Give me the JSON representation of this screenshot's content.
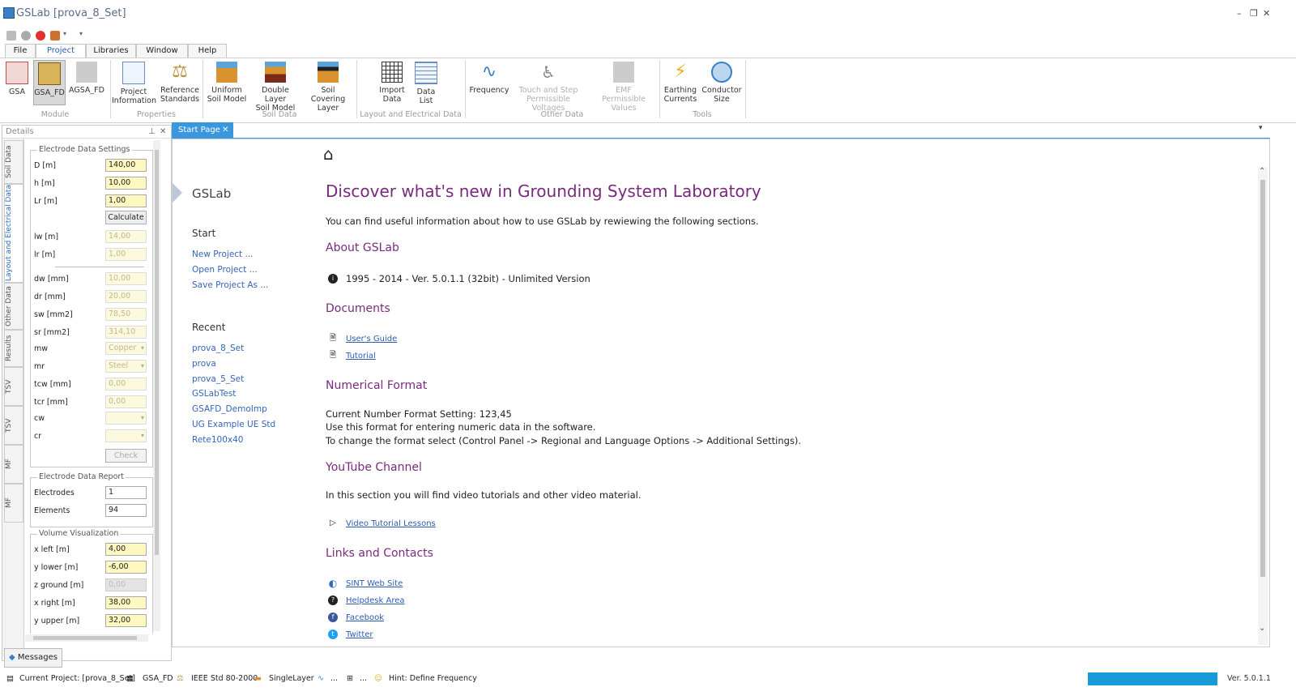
{
  "window": {
    "title": "GSLab [prova_8_Set]"
  },
  "menu_tabs": [
    "File",
    "Project",
    "Libraries",
    "Window",
    "Help"
  ],
  "ribbon": {
    "module": {
      "label": "Module",
      "buttons": [
        "GSA",
        "GSA_FD",
        "AGSA_FD"
      ]
    },
    "properties": {
      "label": "Properties",
      "buttons": [
        [
          "Project",
          "Information"
        ],
        [
          "Reference",
          "Standards"
        ]
      ]
    },
    "soil": {
      "label": "Soil Data",
      "buttons": [
        [
          "Uniform",
          "Soil Model"
        ],
        [
          "Double Layer",
          "Soil Model"
        ],
        [
          "Soil Covering",
          "Layer"
        ]
      ]
    },
    "layout": {
      "label": "Layout and Electrical Data",
      "buttons": [
        [
          "Import",
          "Data"
        ],
        [
          "Data List",
          ""
        ]
      ]
    },
    "other": {
      "label": "Other Data",
      "buttons": [
        [
          "Frequency",
          ""
        ],
        [
          "Touch and Step",
          "Permissible Voltages"
        ],
        [
          "EMF",
          "Permissible Values"
        ]
      ]
    },
    "tools": {
      "label": "Tools",
      "buttons": [
        [
          "Earthing",
          "Currents"
        ],
        [
          "Conductor",
          "Size"
        ]
      ]
    }
  },
  "details": {
    "title": "Details",
    "vtabs": [
      "Soil Data",
      "Layout and Electrical Data",
      "Other Data",
      "Results",
      "TSV",
      "TSV",
      "MF",
      "MF"
    ],
    "electrode_settings": {
      "legend": "Electrode Data Settings",
      "fields": [
        {
          "label": "D [m]",
          "value": "140,00"
        },
        {
          "label": "h [m]",
          "value": "10,00"
        },
        {
          "label": "Lr [m]",
          "value": "1,00"
        }
      ],
      "calculate": "Calculate",
      "fields2": [
        {
          "label": "lw [m]",
          "value": "14,00"
        },
        {
          "label": "lr [m]",
          "value": "1,00"
        }
      ],
      "fields3": [
        {
          "label": "dw [mm]",
          "value": "10,00"
        },
        {
          "label": "dr [mm]",
          "value": "20,00"
        },
        {
          "label": "sw [mm2]",
          "value": "78,50"
        },
        {
          "label": "sr [mm2]",
          "value": "314,10"
        },
        {
          "label": "mw",
          "value": "Copper"
        },
        {
          "label": "mr",
          "value": "Steel"
        },
        {
          "label": "tcw [mm]",
          "value": "0,00"
        },
        {
          "label": "tcr [mm]",
          "value": "0,00"
        },
        {
          "label": "cw",
          "value": ""
        },
        {
          "label": "cr",
          "value": ""
        }
      ],
      "check": "Check"
    },
    "electrode_report": {
      "legend": "Electrode Data Report",
      "fields": [
        {
          "label": "Electrodes",
          "value": "1"
        },
        {
          "label": "Elements",
          "value": "94"
        }
      ]
    },
    "volume": {
      "legend": "Volume Visualization",
      "fields": [
        {
          "label": "x left [m]",
          "value": "4,00"
        },
        {
          "label": "y lower [m]",
          "value": "-6,00"
        },
        {
          "label": "z ground [m]",
          "value": "0,00"
        },
        {
          "label": "x right [m]",
          "value": "38,00"
        },
        {
          "label": "y upper [m]",
          "value": "32,00"
        }
      ]
    }
  },
  "doc_tab": "Start Page",
  "start_page": {
    "nav_title": "GSLab",
    "start_heading": "Start",
    "start_links": [
      "New Project ...",
      "Open Project ...",
      "Save Project As ..."
    ],
    "recent_heading": "Recent",
    "recent": [
      "prova_8_Set",
      "prova",
      "prova_5_Set",
      "GSLabTest",
      "GSAFD_DemoImp",
      "UG Example UE Std",
      "Rete100x40"
    ],
    "headline": "Discover what's new in Grounding System Laboratory",
    "intro": "You can find useful information about how to use GSLab by rewiewing the following sections.",
    "about_heading": "About GSLab",
    "about_text": "1995 - 2014 - Ver. 5.0.1.1 (32bit) - Unlimited Version",
    "docs_heading": "Documents",
    "docs": [
      "User's Guide",
      "Tutorial"
    ],
    "numfmt_heading": "Numerical Format",
    "numfmt_lines": [
      "Current Number Format Setting: 123,45",
      "Use this format for entering numeric data in the software.",
      "To change the format select (Control Panel -> Regional and Language Options -> Additional Settings)."
    ],
    "yt_heading": "YouTube Channel",
    "yt_text": "In this section you will find video tutorials and other video material.",
    "yt_link": "Video Tutorial Lessons",
    "links_heading": "Links and Contacts",
    "links": [
      "SINT Web Site",
      "Helpdesk Area",
      "Facebook",
      "Twitter"
    ]
  },
  "messages_button": "Messages",
  "status": {
    "project": "Current Project: [prova_8_Set]",
    "module": "GSA_FD",
    "standard": "IEEE Std 80-2000",
    "soil": "SingleLayer",
    "freq": "...",
    "other": "...",
    "hint": "Hint: Define Frequency",
    "version": "Ver. 5.0.1.1"
  },
  "colors": {
    "accent": "#3a96dd",
    "heading": "#7a2a7e",
    "link": "#2a5db0"
  }
}
